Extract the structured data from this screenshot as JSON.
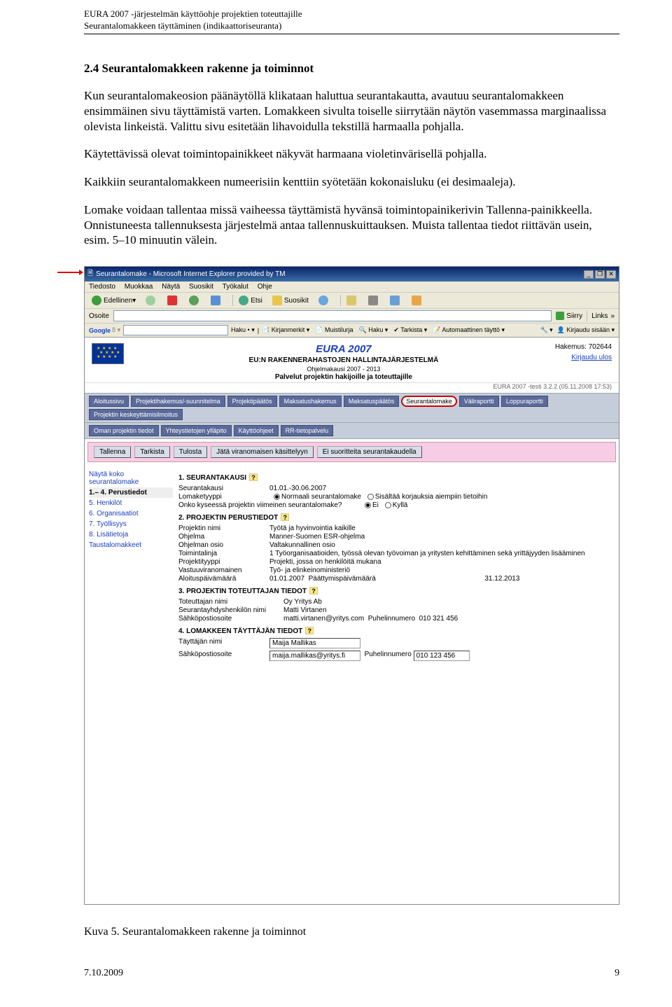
{
  "header": {
    "line1": "EURA 2007 -järjestelmän käyttöohje projektien toteuttajille",
    "line2": "Seurantalomakkeen täyttäminen (indikaattoriseuranta)"
  },
  "section": {
    "title": "2.4 Seurantalomakkeen rakenne ja toiminnot",
    "p1": "Kun seurantalomakeosion päänäytöllä klikataan haluttua seurantakautta, avautuu seurantalomakkeen ensimmäinen sivu täyttämistä varten. Lomakkeen sivulta toiselle siirrytään näytön vasemmassa marginaalissa olevista linkeistä. Valittu sivu esitetään lihavoidulla tekstillä harmaalla pohjalla.",
    "p2": "Käytettävissä olevat toimintopainikkeet näkyvät harmaana violetinvärisellä pohjalla.",
    "p3": "Kaikkiin seurantalomakkeen numeerisiin kenttiin syötetään kokonaisluku (ei desimaaleja).",
    "p4": "Lomake voidaan tallentaa missä vaiheessa täyttämistä hyvänsä toimintopainikerivin Tallenna-painikkeella. Onnistuneesta tallennuksesta järjestelmä antaa tallennuskuittauksen. Muista tallentaa tiedot riittävän usein, esim. 5–10 minuutin välein."
  },
  "ie": {
    "title": "Seurantalomake - Microsoft Internet Explorer provided by TM",
    "menu": {
      "tiedosto": "Tiedosto",
      "muokkaa": "Muokkaa",
      "nayta": "Näytä",
      "suosikit": "Suosikit",
      "tyokalut": "Työkalut",
      "ohje": "Ohje"
    },
    "tb": {
      "back": "Edellinen",
      "etsi": "Etsi",
      "suosikit": "Suosikit"
    },
    "addr_label": "Osoite",
    "siirry": "Siirry",
    "links": "Links",
    "google": {
      "label": "Google",
      "haku": "Haku",
      "kirjanmerkit": "Kirjanmerkit",
      "muistilurja": "Muistilurja",
      "hakulnk": "Haku",
      "tarkista": "Tarkista",
      "auto": "Automaattinen täyttö",
      "kirjaudu": "Kirjaudu sisään"
    }
  },
  "eura": {
    "name": "EURA 2007",
    "sub": "EU:N RAKENNERAHASTOJEN HALLINTAJÄRJESTELMÄ",
    "sub2": "Ohjelmakausi 2007 - 2013",
    "sub3": "Palvelut projektin hakijoille ja toteuttajille",
    "hakemus": "Hakemus: 702644",
    "logout": "Kirjaudu ulos",
    "version": "EURA 2007 -testi 3.2.2 (05.11.2008 17:53)"
  },
  "nav1": {
    "aloitus": "Aloitussivu",
    "hakemus": "Projektihakemus/-suunnitelma",
    "paatos": "Projektipäätös",
    "maksu": "Maksatushakemus",
    "maksup": "Maksatuspäätös",
    "seuranta": "Seurantalomake",
    "vali": "Väliraportti",
    "loppu": "Loppuraportti",
    "kesk": "Projektin keskeyttämisilmoitus"
  },
  "nav2": {
    "oman": "Oman projektin tiedot",
    "yhteys": "Yhteystietojen ylläpito",
    "kaytto": "Käyttöohjeet",
    "rr": "RR-tietopalvelu"
  },
  "actions": {
    "tallenna": "Tallenna",
    "tarkista": "Tarkista",
    "tulosta": "Tulosta",
    "jata": "Jätä viranomaisen käsittelyyn",
    "ei": "Ei suoritteita seurantakaudella"
  },
  "side": {
    "top": "Näytä koko seurantalomake",
    "s1": "1.– 4. Perustiedot",
    "s5": "5. Henkilöt",
    "s6": "6. Organisaatiot",
    "s7": "7. Työllisyys",
    "s8": "8. Lisätietoja",
    "tausta": "Taustalomakkeet"
  },
  "form": {
    "h1": "1. SEURANTAKAUSI",
    "kausi_l": "Seurantakausi",
    "kausi_v": "01.01.-30.06.2007",
    "tyyppi_l": "Lomaketyyppi",
    "tyyppi_o1": "Normaali seurantalomake",
    "tyyppi_o2": "Sisältää korjauksia aiempiin tietoihin",
    "viim_l": "Onko kyseessä projektin viimeinen seurantalomake?",
    "ei": "Ei",
    "kylla": "Kyllä",
    "h2": "2. PROJEKTIN PERUSTIEDOT",
    "p_nimi_l": "Projektin nimi",
    "p_nimi_v": "Työtä ja hyvinvointia kaikille",
    "ohjelma_l": "Ohjelma",
    "ohjelma_v": "Manner-Suomen ESR-ohjelma",
    "osio_l": "Ohjelman osio",
    "osio_v": "Valtakunnallinen osio",
    "tl_l": "Toimintalinja",
    "tl_v": "1 Työorganisaatioiden, työssä olevan työvoiman ja yritysten kehittäminen sekä yrittäjyyden lisääminen",
    "pt_l": "Projektityyppi",
    "pt_v": "Projekti, jossa on henkilöitä mukana",
    "vv_l": "Vastuuviranomainen",
    "vv_v": "Työ- ja elinkeinoministeriö",
    "alku_l": "Aloituspäivämäärä",
    "alku_v": "01.01.2007",
    "loppu_l": "Päättymispäivämäärä",
    "loppu_v": "31.12.2013",
    "h3": "3. PROJEKTIN TOTEUTTAJAN TIEDOT",
    "tot_l": "Toteuttajan nimi",
    "tot_v": "Oy Yritys Ab",
    "yhd_l": "Seurantayhdyshenkilön nimi",
    "yhd_v": "Matti Virtanen",
    "sp_l": "Sähköpostiosoite",
    "sp_v": "matti.virtanen@yritys.com",
    "puh_l": "Puhelinnumero",
    "puh_v": "010 321 456",
    "h4": "4. LOMAKKEEN TÄYTTÄJÄN TIEDOT",
    "tn_l": "Täyttäjän nimi",
    "tn_v": "Maija Mallikas",
    "te_l": "Sähköpostiosoite",
    "te_v": "maija.mallikas@yritys.fi",
    "tp_l": "Puhelinnumero",
    "tp_v": "010 123 456"
  },
  "caption": "Kuva 5. Seurantalomakkeen rakenne ja toiminnot",
  "footer": {
    "left": "7.10.2009",
    "right": "9"
  }
}
